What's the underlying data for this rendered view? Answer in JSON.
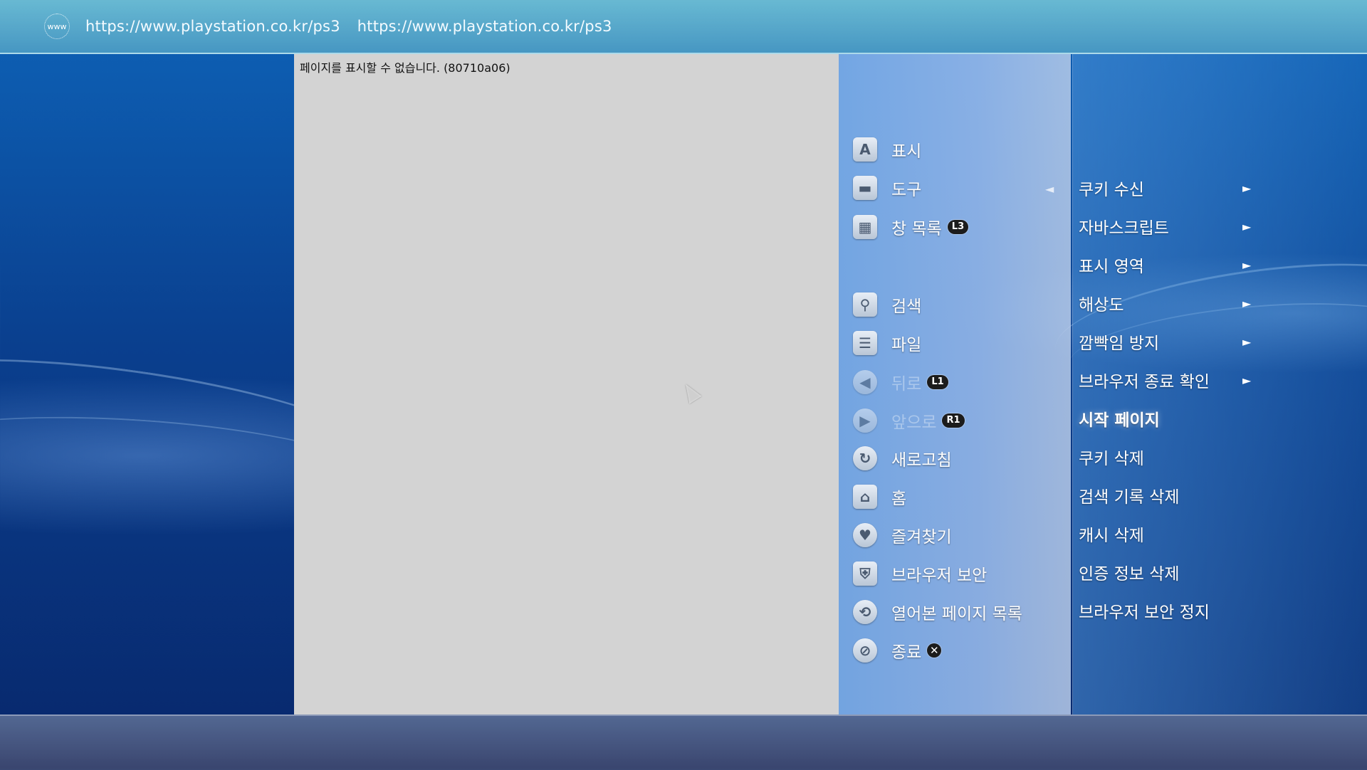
{
  "address_bar": {
    "icon": "www-globe-icon",
    "icon_text": "www",
    "url": "https://www.playstation.co.kr/ps3",
    "title": "https://www.playstation.co.kr/ps3"
  },
  "page": {
    "error_message": "페이지를 표시할 수 없습니다. (80710a06)"
  },
  "main_menu": {
    "items": [
      {
        "label": "표시",
        "icon": "display-a-icon",
        "glyph": "A"
      },
      {
        "label": "도구",
        "icon": "toolbox-icon",
        "glyph": "▬"
      },
      {
        "label": "창 목록",
        "icon": "window-list-icon",
        "glyph": "▦",
        "badge": "L3"
      },
      {
        "label": "검색",
        "icon": "search-icon",
        "glyph": "⚲"
      },
      {
        "label": "파일",
        "icon": "file-icon",
        "glyph": "☰"
      },
      {
        "label": "뒤로",
        "icon": "back-arrow-icon",
        "glyph": "◀",
        "badge": "L1",
        "disabled": true
      },
      {
        "label": "앞으로",
        "icon": "forward-arrow-icon",
        "glyph": "▶",
        "badge": "R1",
        "disabled": true
      },
      {
        "label": "새로고침",
        "icon": "refresh-icon",
        "glyph": "↻"
      },
      {
        "label": "홈",
        "icon": "home-icon",
        "glyph": "⌂"
      },
      {
        "label": "즐겨찾기",
        "icon": "heart-icon",
        "glyph": "♥"
      },
      {
        "label": "브라우저 보안",
        "icon": "shield-icon",
        "glyph": "⛨"
      },
      {
        "label": "열어본 페이지 목록",
        "icon": "history-icon",
        "glyph": "⟲"
      },
      {
        "label": "종료",
        "icon": "exit-icon",
        "glyph": "⊘",
        "badge": "✕"
      }
    ]
  },
  "sub_menu": {
    "items": [
      {
        "label": "쿠키 수신",
        "has_arrow": true
      },
      {
        "label": "자바스크립트",
        "has_arrow": true
      },
      {
        "label": "표시 영역",
        "has_arrow": true
      },
      {
        "label": "해상도",
        "has_arrow": true
      },
      {
        "label": "깜빡임 방지",
        "has_arrow": true
      },
      {
        "label": "브라우저 종료 확인",
        "has_arrow": true
      },
      {
        "label": "시작 페이지",
        "selected": true
      },
      {
        "label": "쿠키 삭제"
      },
      {
        "label": "검색 기록 삭제"
      },
      {
        "label": "캐시 삭제"
      },
      {
        "label": "인증 정보 삭제"
      },
      {
        "label": "브라우저 보안 정지"
      }
    ],
    "arrow_glyph": "►",
    "back_glyph": "◄"
  }
}
